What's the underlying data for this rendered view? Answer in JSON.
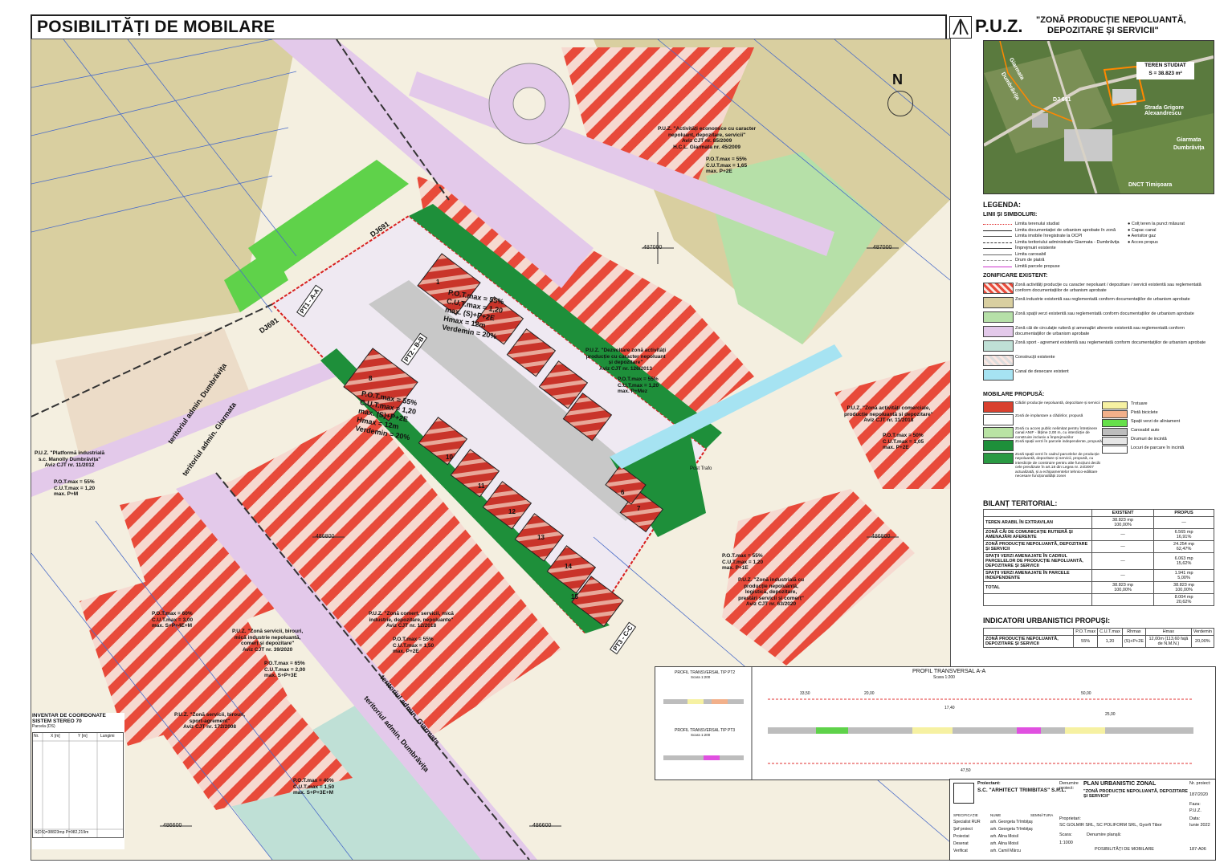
{
  "title": "POSIBILITĂȚI DE MOBILARE",
  "puz": {
    "abbr": "P.U.Z.",
    "subtitle_1": "\"ZONĂ PRODUCȚIE NEPOLUANTĂ,",
    "subtitle_2": "DEPOZITARE ȘI SERVICII\""
  },
  "north": "N",
  "aerial": {
    "box_line1": "TEREN STUDIAT",
    "box_line2": "S = 38.823 m²",
    "labels": [
      "Giarmata",
      "Dumbrăvița",
      "DJ 691",
      "Strada Grigore Alexandrescu",
      "Giarmata",
      "Dumbrăvița",
      "DNCT Timișoara"
    ]
  },
  "legend": {
    "title": "LEGENDA:",
    "lines_title": "LINII ȘI SIMBOLURI:",
    "lines": [
      {
        "label": "Limita terenului studiat",
        "color": "#e03030",
        "style": "dotted"
      },
      {
        "label": "Limita documentației de urbanism aprobate în zonă",
        "color": "#222222",
        "style": "solid"
      },
      {
        "label": "Limita imobile înregistrate la OCPI",
        "color": "#555555",
        "style": "solid"
      },
      {
        "label": "Limita teritoriului administrativ Giarmata - Dumbrăvița",
        "color": "#333333",
        "style": "dashed"
      },
      {
        "label": "Împrejmuiri existente",
        "color": "#444444",
        "style": "cross"
      },
      {
        "label": "Limita carosabil",
        "color": "#666666",
        "style": "solid"
      },
      {
        "label": "Drum de piatră",
        "color": "#999999",
        "style": "dashed"
      },
      {
        "label": "Limită parcele propuse",
        "color": "#cc33cc",
        "style": "solid"
      }
    ],
    "symbols": [
      "Colț teren la punct măsurat",
      "Capac canal",
      "Aerisitor gaz",
      "Acces propus"
    ],
    "zoning_title": "ZONIFICARE EXISTENT:",
    "zoning": [
      {
        "label": "Zonă activități producție cu caracter nepoluant / depozitare / servicii existentă sau reglementată conform documentațiilor de urbanism aprobate",
        "fill": "#e84a3a",
        "hatch": true
      },
      {
        "label": "Zonă industrie existentă sau reglementată conform documentațiilor de urbanism aprobate",
        "fill": "#d9cfa0",
        "hatch": false
      },
      {
        "label": "Zonă spații verzi existentă sau reglementată conform documentațiilor de urbanism aprobate",
        "fill": "#b6e0a8",
        "hatch": false
      },
      {
        "label": "Zonă căi de circulație rutieră și amenajări aferente existentă sau reglementată conform documentațiilor de urbanism aprobate",
        "fill": "#e3c9ea",
        "hatch": false
      },
      {
        "label": "Zonă sport - agrement existentă sau reglementată conform documentațiilor de urbanism aprobate",
        "fill": "#bfe0d6",
        "hatch": false
      },
      {
        "label": "Construcții existente",
        "fill": "#dddddd",
        "hatch": true
      },
      {
        "label": "Canal de desecare existent",
        "fill": "#a6e3f2",
        "hatch": false
      }
    ],
    "mobilare_title": "MOBILARE PROPUSĂ:",
    "mobilare_left": [
      {
        "label": "Clădiri producție nepoluantă, depozitare și servicii",
        "fill": "#d9412f"
      },
      {
        "label": "Zonă de implantare a clădirilor, propusă",
        "fill": "#ffffff"
      },
      {
        "label": "Zonă cu acces public nelimitat pentru întreținere canal ANIF - lățime 2,00 m, cu interdicție de construire inclusiv a împrejmuirilor",
        "fill": "#b9e3a4"
      },
      {
        "label": "Zonă spații verzi în parcele independente, propusă",
        "fill": "#1e8f3a"
      },
      {
        "label": "Zonă spații verzi în cadrul parcelelor de producție nepoluantă, depozitare și servicii, propusă, cu interdicție de construire pentru alte funcțiuni decât cele prevăzute în art.18 din Legea nr. 24/2007 actualizată, și a echipamentelor tehnico-edilitare necesare funcționalității zonei",
        "fill": "#2a9a43"
      }
    ],
    "mobilare_right": [
      {
        "label": "Trotuare",
        "fill": "#f6f1a2"
      },
      {
        "label": "Pistă biciclete",
        "fill": "#f2b08a"
      },
      {
        "label": "Spații verzi de aliniament",
        "fill": "#66e04a"
      },
      {
        "label": "Carosabil auto",
        "fill": "#bdbdbd"
      },
      {
        "label": "Drumuri de incintă",
        "fill": "#e6e6e6"
      },
      {
        "label": "Locuri de parcare în incintă",
        "fill": "#ffffff"
      }
    ]
  },
  "bilant": {
    "title": "BILANȚ TERITORIAL:",
    "col_existent": "EXISTENT",
    "col_propus": "PROPUS",
    "rows": [
      {
        "label": "TEREN ARABIL ÎN EXTRAVILAN",
        "existent": "38.823 mp",
        "existent_pct": "100,00%",
        "propus": "—",
        "propus_pct": ""
      },
      {
        "label": "ZONĂ CĂI DE COMUNICAȚIE RUTIERĂ ȘI AMENAJĂRI AFERENTE",
        "existent": "—",
        "existent_pct": "",
        "propus": "6.565 mp",
        "propus_pct": "16,91%"
      },
      {
        "label": "ZONĂ PRODUCȚIE NEPOLUANTĂ, DEPOZITARE ȘI SERVICII",
        "existent": "—",
        "existent_pct": "",
        "propus": "24.254 mp",
        "propus_pct": "62,47%"
      },
      {
        "label": "SPAȚII VERZI AMENAJATE ÎN CADRUL PARCELELOR DE PRODUCȚIE NEPOLUANTĂ, DEPOZITARE ȘI SERVICII",
        "existent": "—",
        "existent_pct": "",
        "propus": "6.063 mp",
        "propus_pct": "15,62%"
      },
      {
        "label": "SPAȚII VERZI AMENAJATE ÎN PARCELE INDEPENDENTE",
        "existent": "—",
        "existent_pct": "",
        "propus": "1.941 mp",
        "propus_pct": "5,00%"
      },
      {
        "label": "TOTAL",
        "existent": "38.823 mp",
        "existent_pct": "100,00%",
        "propus": "38.823 mp",
        "propus_pct": "100,00%"
      }
    ],
    "green_total": "8.004 mp",
    "green_total_pct": "20,62%"
  },
  "indicatori": {
    "title": "INDICATORI URBANISTICI PROPUȘI:",
    "headers": [
      "P.O.T.max",
      "C.U.T.max",
      "Rhmax",
      "Hmax",
      "Verdemin"
    ],
    "row_label": "ZONĂ PRODUCȚIE NEPOLUANTĂ, DEPOZITARE ȘI SERVICII",
    "values": [
      "55%",
      "1,20",
      "(S)+P+2E",
      "12,00m (113,60 față de N.M.N.)",
      "20,00%"
    ]
  },
  "map_labels": {
    "puz_nw": [
      "P.U.Z. \"Activități economice cu caracter",
      "nepoluant, depozitare, servicii\"",
      "Aviz CJT nr. 85/2009",
      "H.C.L. Giarmata nr. 45/2009"
    ],
    "puz_nw_ind": [
      "P.O.T.max = 55%",
      "C.U.T.max = 1,65",
      "max. P+2E"
    ],
    "puz_center": [
      "P.U.Z. \"Dezvoltare zonă activități",
      "producție cu caracter nepoluant",
      "și depozitare\"",
      "Aviz CJT nr. 126/2013"
    ],
    "puz_center_ind": [
      "P.O.T.max = 55%",
      "C.U.T.max = 1,20",
      "max. P+Mez"
    ],
    "puz_right": [
      "P.U.Z. \"Zonă activități comerciale,",
      "producție nepoluantă și depozitare\"",
      "Aviz CJT nr. 11/2018"
    ],
    "puz_right_ind": [
      "P.O.T.max = 50%",
      "C.U.T.max = 1,05",
      "max. P+2E"
    ],
    "puz_left": [
      "P.U.Z. \"Platformă industrială",
      "s.c. Manolly Dumbrăvița\"",
      "Aviz CJT nr. 11/2012"
    ],
    "puz_left_ind": [
      "P.O.T.max = 55%",
      "C.U.T.max = 1,20",
      "max. P+M"
    ],
    "puz_mid_low": [
      "P.U.Z. \"Zonă comerț, servicii, mică",
      "industrie, depozitare, nepoluante\"",
      "Aviz CJT nr. 12/2018"
    ],
    "puz_mid_low_ind": [
      "P.O.T.max = 55%",
      "C.U.T.max = 1,50",
      "max. P+2E"
    ],
    "puz_low_left": [
      "P.U.Z. \"Zonă servicii, birouri,",
      "mică industrie nepoluantă,",
      "comerț și depozitare\"",
      "Aviz CJT nr. 39/2020"
    ],
    "puz_low_left_ind": [
      "P.O.T.max = 60%",
      "C.U.T.max = 3,00",
      "max. S+P+4E+M"
    ],
    "puz_low_left_ind2": [
      "P.O.T.max = 65%",
      "C.U.T.max = 2,00",
      "max. S+P+3E"
    ],
    "puz_sport": [
      "P.U.Z. \"Zonă servicii, birouri,",
      "sport-agrement\"",
      "Aviz CJT nr. 172/2008"
    ],
    "puz_sport_ind": [
      "P.O.T.max = 40%",
      "C.U.T.max = 1,50",
      "max. S+P+3E+M"
    ],
    "puz_se": [
      "P.U.Z. \"Zonă industrială cu",
      "producție nepoluantă,",
      "logistică, depozitare,",
      "prestări servicii și comerț\"",
      "Aviz CJT nr. 63/2020"
    ],
    "puz_se_ind": [
      "P.O.T.max = 55%",
      "C.U.T.max = 1,20",
      "max. P+1E"
    ],
    "site_ind_a": [
      "P.O.T.max = 55%",
      "C.U.T.max = 1,20",
      "max. (S)+P+2E",
      "Hmax = 12m",
      "Verdemin = 20%"
    ],
    "site_ind_b": [
      "P.O.T.max = 55%",
      "C.U.T.max = 1,20",
      "max. (S)+P+2E",
      "Hmax = 12m",
      "Verdemin = 20%"
    ],
    "dj": [
      "DJ691",
      "DJ691"
    ],
    "pt": "PT1 - A-A",
    "pt_b": "PT2 - B-B",
    "pt_c": "PT3 - C-C",
    "teritoriu": [
      "teritoriul admin. Dumbrăvița",
      "teritoriul admin. Giarmata",
      "teritoriul admin. Giarmata",
      "teritoriul admin. Dumbrăvița"
    ],
    "coords": [
      "487000",
      "487000",
      "486800",
      "486800",
      "486600",
      "486600",
      "210600",
      "210800",
      "211000"
    ],
    "post_trafo": "Post Trafo",
    "lots": [
      "1",
      "2",
      "3",
      "4",
      "5",
      "6",
      "7",
      "8",
      "9",
      "10",
      "11",
      "12",
      "13",
      "14",
      "15",
      "16",
      "17",
      "18",
      "19",
      "20"
    ]
  },
  "coord_table": {
    "title_1": "INVENTAR DE COORDONATE",
    "title_2": "SISTEM STEREO 70",
    "sub": "Parcela (DS)",
    "headers": [
      "Nr.",
      "X [m]",
      "Y [m]",
      "Lungimi"
    ],
    "total": "S(DS)=38823mp  P=982,219m"
  },
  "profiles": {
    "small_title_1": "PROFIL TRANSVERSAL TIP PT2",
    "small_title_2": "PROFIL TRANSVERSAL TIP PT3",
    "scale_small": "Scara 1:200",
    "big_title": "PROFIL TRANSVERSAL A-A",
    "scale_big": "Scara 1:200",
    "dims": [
      "33,50",
      "20,00",
      "13,50",
      "17,40",
      "47,50",
      "50,00",
      "25,00",
      "12,00"
    ]
  },
  "cartouche": {
    "proiectant_lbl": "Proiectant:",
    "proiectant": "S.C. \"ARHITECT TRIMBITAS\" S.R.L.",
    "denumire_lbl": "Denumire proiect:",
    "proiect": "PLAN URBANISTIC ZONAL",
    "proiect_sub": "\"ZONĂ PRODUCȚIE NEPOLUANTĂ, DEPOZITARE ȘI SERVICII\"",
    "nr_proiect_lbl": "Nr. proiect:",
    "nr_proiect": "187/2020",
    "faza_lbl": "Faza:",
    "faza": "P.U.Z.",
    "beneficiar_lbl": "Proprietari:",
    "beneficiar": "SC GOLMIR SRL, SC POLIFORM SRL, Gyorfi Tibor",
    "data_lbl": "Data:",
    "data": "Iunie 2022",
    "plansa_lbl": "Denumire planșă:",
    "plansa": "POSIBILITĂȚI DE MOBILARE",
    "scara_lbl": "Scara:",
    "scara": "1:1000",
    "nr_plansa": "187-A06",
    "roles": [
      {
        "role": "Specialist RUR",
        "name": "arh. Georgeta Trîmbiţaş"
      },
      {
        "role": "Șef proiect",
        "name": "arh. Georgeta Trîmbiţaş"
      },
      {
        "role": "Proiectat",
        "name": "arh. Alina Moisil"
      },
      {
        "role": "Desenat",
        "name": "arh. Alina Moisil"
      },
      {
        "role": "Verificat",
        "name": "arh. Camil Mârcu"
      }
    ],
    "col_spec": "SPECIFICAȚIE",
    "col_nume": "NUME",
    "col_semn": "SEMNĂTURA"
  },
  "colors": {
    "hatch_red": "#e84a3a",
    "industry": "#d9cfa0",
    "green": "#b6e0a8",
    "road": "#e3c9ea",
    "proposed_green": "#1e8f3a",
    "building": "#d9412f",
    "canal": "#a6e3f2"
  }
}
